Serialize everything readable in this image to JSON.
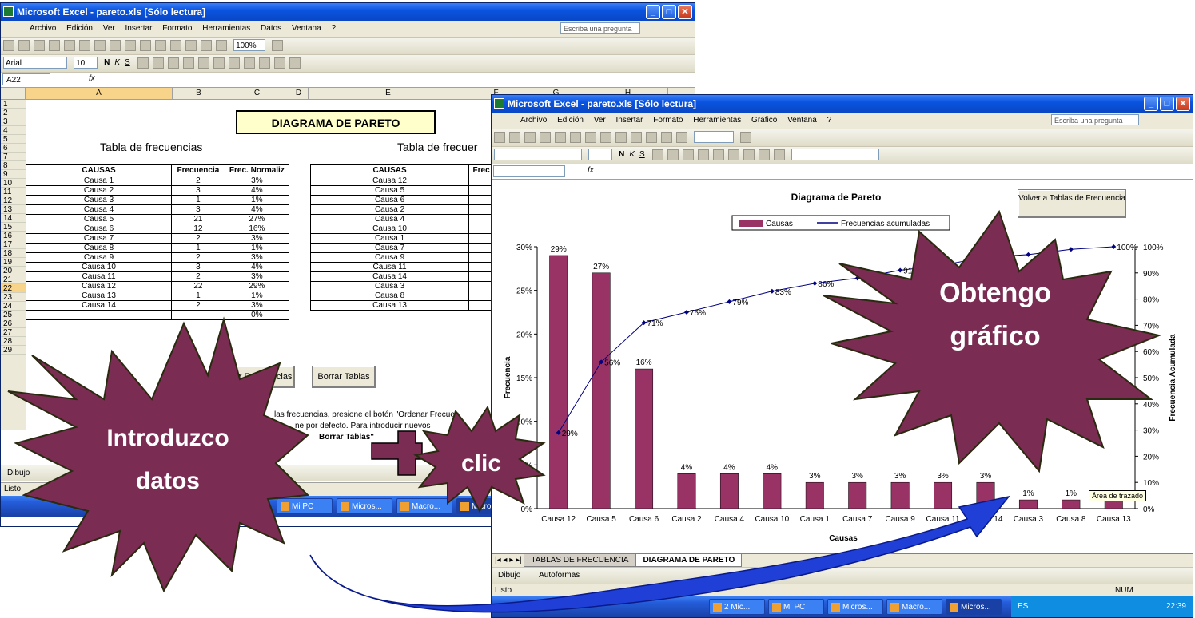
{
  "back_window": {
    "title": "Microsoft Excel - pareto.xls  [Sólo lectura]",
    "menu": [
      "Archivo",
      "Edición",
      "Ver",
      "Insertar",
      "Formato",
      "Herramientas",
      "Datos",
      "Ventana",
      "?"
    ],
    "ask_placeholder": "Escriba una pregunta",
    "zoom": "100%",
    "font_name": "Arial",
    "font_size": "10",
    "name_box": "A22",
    "fx": "fx",
    "columns": [
      "A",
      "B",
      "C",
      "D",
      "E",
      "F",
      "G",
      "H"
    ],
    "rows": [
      "1",
      "2",
      "3",
      "4",
      "5",
      "6",
      "7",
      "8",
      "9",
      "10",
      "11",
      "12",
      "13",
      "14",
      "15",
      "16",
      "17",
      "18",
      "19",
      "20",
      "21",
      "22",
      "23",
      "24",
      "25",
      "26",
      "27",
      "28",
      "29"
    ],
    "sheet_title": "DIAGRAMA DE PARETO",
    "left_subtitle": "Tabla de frecuencias",
    "right_subtitle": "Tabla de frecuer",
    "left_table_headers": [
      "CAUSAS",
      "Frecuencia",
      "Frec. Normaliz"
    ],
    "left_table_rows": [
      [
        "Causa 1",
        "2",
        "3%"
      ],
      [
        "Causa 2",
        "3",
        "4%"
      ],
      [
        "Causa 3",
        "1",
        "1%"
      ],
      [
        "Causa 4",
        "3",
        "4%"
      ],
      [
        "Causa 5",
        "21",
        "27%"
      ],
      [
        "Causa 6",
        "12",
        "16%"
      ],
      [
        "Causa 7",
        "2",
        "3%"
      ],
      [
        "Causa 8",
        "1",
        "1%"
      ],
      [
        "Causa 9",
        "2",
        "3%"
      ],
      [
        "Causa 10",
        "3",
        "4%"
      ],
      [
        "Causa 11",
        "2",
        "3%"
      ],
      [
        "Causa 12",
        "22",
        "29%"
      ],
      [
        "Causa 13",
        "1",
        "1%"
      ],
      [
        "Causa 14",
        "2",
        "3%"
      ],
      [
        "",
        "",
        "0%"
      ]
    ],
    "right_table_headers": [
      "CAUSAS",
      "Frec"
    ],
    "right_table_rows": [
      "Causa 12",
      "Causa 5",
      "Causa 6",
      "Causa 2",
      "Causa 4",
      "Causa 10",
      "Causa 1",
      "Causa 7",
      "Causa 9",
      "Causa 11",
      "Causa 14",
      "Causa 3",
      "Causa 8",
      "Causa 13"
    ],
    "order_button": "nar Frecuencias",
    "clear_button": "Borrar Tablas",
    "note_line1": "las frecuencias, presione el botón \"Ordenar Frecuen",
    "note_line2": "ne por defecto. Para introducir nuevos",
    "note_line3": "Borrar Tablas\"",
    "draw_label": "Dibujo",
    "status": "Listo",
    "taskbar_items": [
      "Mi PC",
      "Micros...",
      "Macro...",
      "Micro"
    ]
  },
  "front_window": {
    "title": "Microsoft Excel - pareto.xls  [Sólo lectura]",
    "menu": [
      "Archivo",
      "Edición",
      "Ver",
      "Insertar",
      "Formato",
      "Herramientas",
      "Gráfico",
      "Ventana",
      "?"
    ],
    "ask_placeholder": "Escriba una pregunta",
    "fx": "fx",
    "chart_button": "Volver a Tablas de Frecuencia",
    "sheet_tabs": [
      "TABLAS DE FRECUENCIA",
      "DIAGRAMA DE PARETO"
    ],
    "draw_label": "Dibujo",
    "autoshapes": "Autoformas",
    "status": "Listo",
    "num": "NUM",
    "tooltip": "Área de trazado",
    "taskbar_items": [
      "2 Mic...",
      "Mi PC",
      "Micros...",
      "Macro...",
      "Micros..."
    ],
    "lang": "ES",
    "clock": "22:39"
  },
  "chart_data": {
    "type": "bar",
    "title": "Diagrama de Pareto",
    "xlabel": "Causas",
    "ylabel": "Frecuencia",
    "y2label": "Frecuencia Acumulada",
    "categories": [
      "Causa 12",
      "Causa 5",
      "Causa 6",
      "Causa 2",
      "Causa 4",
      "Causa 10",
      "Causa 1",
      "Causa 7",
      "Causa 9",
      "Causa 11",
      "Causa 14",
      "Causa 3",
      "Causa 8",
      "Causa 13"
    ],
    "series": [
      {
        "name": "Causas",
        "values": [
          29,
          27,
          16,
          4,
          4,
          4,
          3,
          3,
          3,
          3,
          3,
          1,
          1,
          1
        ],
        "color": "#993366"
      },
      {
        "name": "Frecuencias acumuladas",
        "values": [
          29,
          56,
          71,
          75,
          79,
          83,
          86,
          88,
          91,
          93,
          96,
          97,
          99,
          100
        ],
        "color": "#000080"
      }
    ],
    "bar_labels": [
      "29%",
      "27%",
      "16%",
      "4%",
      "4%",
      "4%",
      "3%",
      "3%",
      "3%",
      "3%",
      "3%",
      "1%",
      "1%",
      "1%"
    ],
    "line_labels": [
      "29%",
      "56%",
      "71%",
      "75%",
      "79%",
      "83%",
      "86%",
      "88%",
      "91%",
      "",
      "",
      "",
      "",
      "100%"
    ],
    "y_ticks": [
      "0%",
      "5%",
      "10%",
      "15%",
      "20%",
      "25%",
      "30%"
    ],
    "y2_ticks": [
      "0%",
      "10%",
      "20%",
      "30%",
      "40%",
      "50%",
      "60%",
      "70%",
      "80%",
      "90%",
      "100%"
    ],
    "ylim": [
      0,
      30
    ],
    "y2lim": [
      0,
      100
    ],
    "legend_position": "top"
  },
  "annotations": {
    "introduce": [
      "Introduzco",
      "datos"
    ],
    "click": "clic",
    "result": [
      "Obtengo",
      "gráfico"
    ],
    "burst_color": "#7a2c52",
    "arrow_color": "#1f3fd6"
  }
}
